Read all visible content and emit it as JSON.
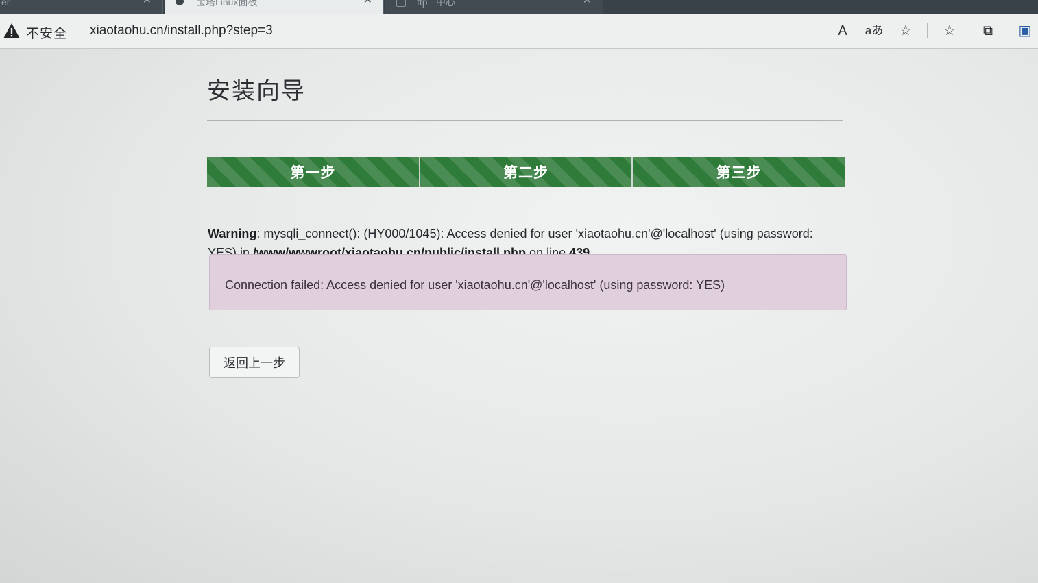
{
  "browser": {
    "tabs": [
      {
        "title": "er",
        "active": false
      },
      {
        "title": "宝塔Linux面板",
        "active": true
      },
      {
        "title": "ftp - 中心",
        "active": false
      }
    ],
    "tab_close_glyph": "✕",
    "security_label": "不安全",
    "url": "xiaotaohu.cn/install.php?step=3",
    "toolbar_icons": [
      "read-aloud-icon",
      "translate-icon",
      "add-favorite-icon",
      "favorites-icon",
      "collections-icon",
      "extensions-icon"
    ],
    "toolbar_glyphs": {
      "read_aloud": "A",
      "translate": "aあ",
      "add_favorite": "☆",
      "favorites": "☆",
      "collections": "⧉",
      "extensions": "▣"
    }
  },
  "page": {
    "title": "安装向导",
    "steps": [
      {
        "label": "第一步"
      },
      {
        "label": "第二步"
      },
      {
        "label": "第三步"
      }
    ],
    "progress_color": "#2f7b3a",
    "warning": {
      "label": "Warning",
      "message": ": mysqli_connect(): (HY000/1045): Access denied for user 'xiaotaohu.cn'@'localhost' (using password: YES) in ",
      "file": "/www/wwwroot/xiaotaohu.cn/public/install.php",
      "line_text": " on line ",
      "line_number": "439"
    },
    "alert": {
      "text": "Connection failed: Access denied for user 'xiaotaohu.cn'@'localhost' (using password: YES)",
      "background": "#e0cfdd"
    },
    "back_button": "返回上一步"
  }
}
